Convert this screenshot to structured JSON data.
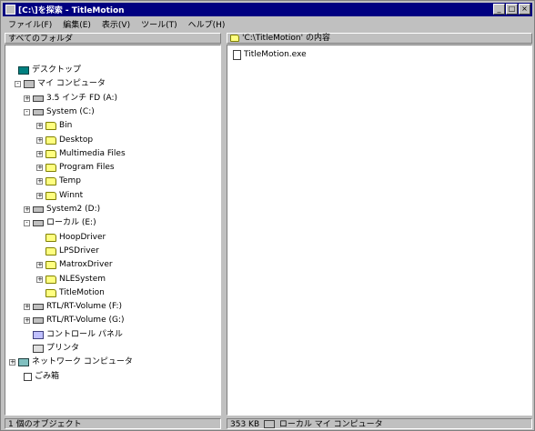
{
  "window": {
    "title": "[C:\\]を探索 - TitleMotion",
    "controls": [
      "_",
      "□",
      "×"
    ]
  },
  "menu": [
    "ファイル(F)",
    "編集(E)",
    "表示(V)",
    "ツール(T)",
    "ヘルプ(H)"
  ],
  "left_pane": {
    "header": "すべてのフォルダ"
  },
  "right_pane": {
    "header": "'C:\\TitleMotion' の内容",
    "files": [
      {
        "name": "TitleMotion.exe",
        "icon": "document-icon"
      }
    ]
  },
  "tree": [
    {
      "label": "デスクトップ",
      "icon": "desktop-icon",
      "expander": ""
    },
    {
      "label": "マイ コンピュータ",
      "icon": "computer-icon",
      "expander": "-"
    },
    {
      "label": "3.5 インチ FD (A:)",
      "icon": "drive-icon",
      "expander": "+"
    },
    {
      "label": "System (C:)",
      "icon": "drive-icon",
      "expander": "-"
    },
    {
      "label": "Bin",
      "icon": "folder-icon",
      "expander": "+"
    },
    {
      "label": "Desktop",
      "icon": "folder-icon",
      "expander": "+"
    },
    {
      "label": "Multimedia Files",
      "icon": "folder-icon",
      "expander": "+"
    },
    {
      "label": "Program Files",
      "icon": "folder-icon",
      "expander": "+"
    },
    {
      "label": "Temp",
      "icon": "folder-icon",
      "expander": "+"
    },
    {
      "label": "Winnt",
      "icon": "folder-icon",
      "expander": "+"
    },
    {
      "label": "System2 (D:)",
      "icon": "drive-icon",
      "expander": "+"
    },
    {
      "label": "ローカル (E:)",
      "icon": "drive-icon",
      "expander": "-"
    },
    {
      "label": "HoopDriver",
      "icon": "folder-icon",
      "expander": ""
    },
    {
      "label": "LPSDriver",
      "icon": "folder-icon",
      "expander": ""
    },
    {
      "label": "MatroxDriver",
      "icon": "folder-icon",
      "expander": "+"
    },
    {
      "label": "NLESystem",
      "icon": "folder-icon",
      "expander": "+"
    },
    {
      "label": "TitleMotion",
      "icon": "folder-icon",
      "expander": ""
    },
    {
      "label": "RTL/RT-Volume (F:)",
      "icon": "drive-icon",
      "expander": "+"
    },
    {
      "label": "RTL/RT-Volume (G:)",
      "icon": "drive-icon",
      "expander": "+"
    },
    {
      "label": "コントロール パネル",
      "icon": "control-panel-icon",
      "expander": ""
    },
    {
      "label": "プリンタ",
      "icon": "printer-icon",
      "expander": ""
    },
    {
      "label": "ネットワーク コンピュータ",
      "icon": "network-icon",
      "expander": "+"
    },
    {
      "label": "ごみ箱",
      "icon": "recycle-bin-icon",
      "expander": ""
    }
  ],
  "status": {
    "left": "1 個のオブジェクト",
    "right_size": "353 KB",
    "right_location": "ローカル マイ コンピュータ"
  }
}
